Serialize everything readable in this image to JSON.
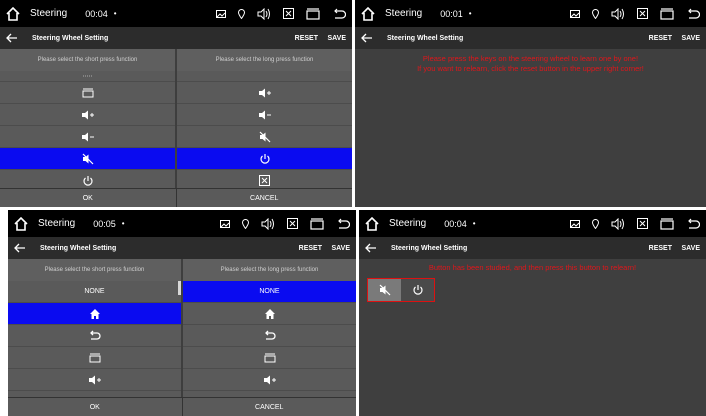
{
  "panels": [
    {
      "app": "Steering",
      "time": "00:04",
      "dot": "•"
    },
    {
      "app": "Steering",
      "time": "00:01",
      "dot": "•"
    },
    {
      "app": "Steering",
      "time": "00:05",
      "dot": "•"
    },
    {
      "app": "Steering",
      "time": "00:04",
      "dot": "•"
    }
  ],
  "title": "Steering Wheel Setting",
  "reset": "RESET",
  "save": "SAVE",
  "short_header": "Please select the short press function",
  "long_header": "Please select the long press function",
  "ok": "OK",
  "cancel": "CANCEL",
  "none": "NONE",
  "prompt_line1": "Please press the keys on the steering wheel to learn one by one!",
  "prompt_line2": "If you want to relearn, click the reset button in the upper right corner!",
  "studied_msg": "Button has been studied, and then press this button to relearn!",
  "accent": "#0a0bf0",
  "message_color": "#e0161b"
}
